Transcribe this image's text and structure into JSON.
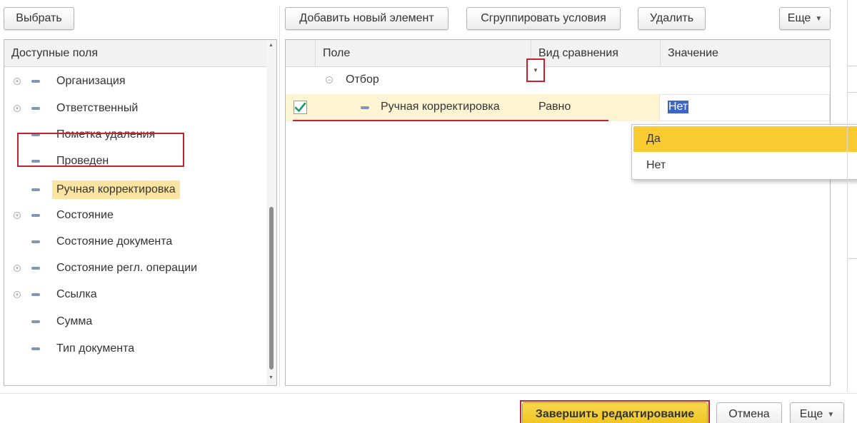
{
  "toolbar_left": {
    "select_label": "Выбрать"
  },
  "toolbar_right": {
    "add_label": "Добавить новый элемент",
    "group_label": "Сгруппировать условия",
    "delete_label": "Удалить",
    "more_label": "Еще"
  },
  "left_panel": {
    "header": "Доступные поля",
    "items": [
      {
        "label": "Организация",
        "expandable": true
      },
      {
        "label": "Ответственный",
        "expandable": true
      },
      {
        "label": "Пометка удаления",
        "expandable": false
      },
      {
        "label": "Проведен",
        "expandable": false
      },
      {
        "label": "Ручная корректировка",
        "expandable": false,
        "selected": true
      },
      {
        "label": "Состояние",
        "expandable": true
      },
      {
        "label": "Состояние документа",
        "expandable": false
      },
      {
        "label": "Состояние регл. операции",
        "expandable": true
      },
      {
        "label": "Ссылка",
        "expandable": true
      },
      {
        "label": "Сумма",
        "expandable": false
      },
      {
        "label": "Тип документа",
        "expandable": false
      }
    ]
  },
  "grid": {
    "columns": [
      "Поле",
      "Вид сравнения",
      "Значение"
    ],
    "group_label": "Отбор",
    "row": {
      "checked": true,
      "field": "Ручная корректировка",
      "comparison": "Равно",
      "value": "Нет"
    }
  },
  "dropdown": {
    "options": [
      "Да",
      "Нет"
    ],
    "active_index": 0
  },
  "footer": {
    "finish_label": "Завершить редактирование",
    "cancel_label": "Отмена",
    "more_label": "Еще"
  },
  "colors": {
    "highlight_red": "#c8202e",
    "selected_item": "#fbe4a1",
    "dropdown_active": "#f9cb30",
    "checkmark_green": "#1f9a63"
  }
}
